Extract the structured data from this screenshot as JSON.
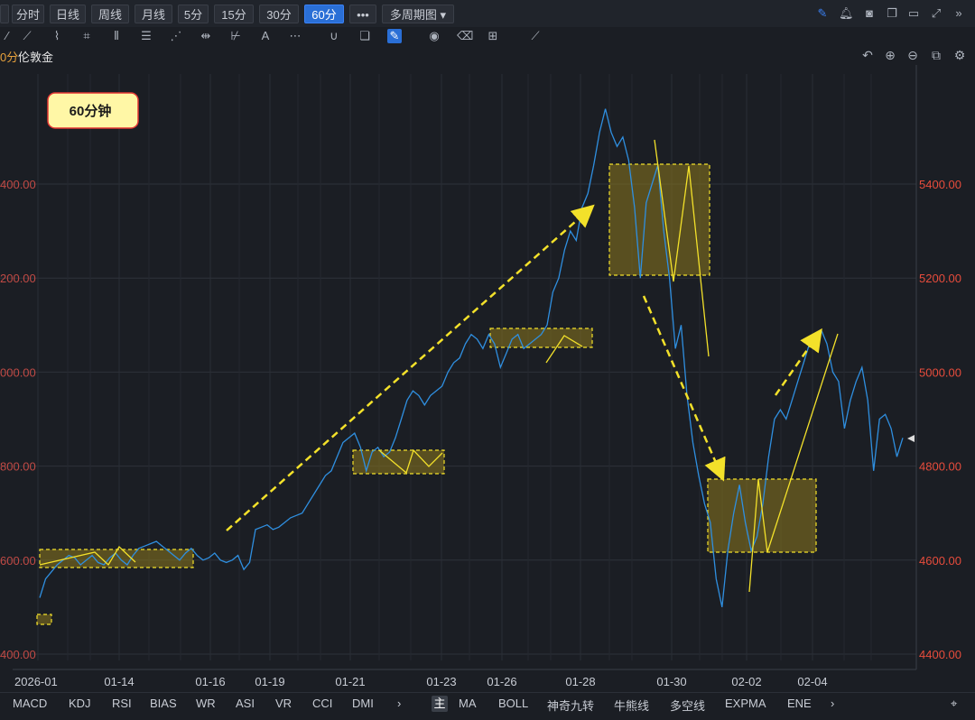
{
  "tabs": [
    "分时",
    "日线",
    "周线",
    "月线",
    "5分",
    "15分",
    "30分",
    "60分",
    "•••",
    "多周期图 ▾"
  ],
  "active_tab": "60分",
  "chart_prefix": "0分",
  "chart_title": "伦敦金",
  "indicators_left": [
    "MACD",
    "KDJ",
    "RSI",
    "BIAS",
    "WR",
    "ASI",
    "VR",
    "CCI",
    "DMI",
    "›"
  ],
  "indicators_main": "主",
  "indicators_right": [
    "MA",
    "BOLL",
    "神奇九转",
    "牛熊线",
    "多空线",
    "EXPMA",
    "ENE",
    "›"
  ],
  "annotation_label": "60分钟",
  "colors": {
    "series": "#2f8fe0",
    "annotation": "#f3e12a",
    "price_right": "#e74c3c",
    "box_fill": "#7a6b1f",
    "label_bg": "#fff7a6",
    "label_border": "#e53935"
  },
  "chart_data": {
    "type": "line",
    "title": "伦敦金",
    "x_ticks": [
      "2026-01",
      "01-14",
      "01-16",
      "01-19",
      "01-21",
      "01-23",
      "01-26",
      "01-28",
      "01-30",
      "02-02",
      "02-04"
    ],
    "y_ticks_left": [
      "400.00",
      "600.00",
      "800.00",
      "000.00",
      "200.00",
      "400.00"
    ],
    "y_ticks_right": [
      "4400.00",
      "4600.00",
      "4800.00",
      "5000.00",
      "5200.00",
      "5400.00"
    ],
    "ylim": [
      4400,
      5500
    ],
    "series": [
      {
        "values": [
          4520,
          4560,
          4575,
          4590,
          4600,
          4610,
          4605,
          4590,
          4600,
          4610,
          4595,
          4590,
          4605,
          4615,
          4600,
          4590,
          4610,
          4625,
          4630,
          4635,
          4640,
          4630,
          4620,
          4610,
          4600,
          4615,
          4625,
          4610,
          4600,
          4605,
          4615,
          4600,
          4595,
          4600,
          4610,
          4580,
          4595,
          4665,
          4670,
          4675,
          4665,
          4670,
          4680,
          4690,
          4695,
          4700,
          4720,
          4740,
          4760,
          4780,
          4790,
          4820,
          4850,
          4860,
          4870,
          4840,
          4790,
          4830,
          4840,
          4820,
          4830,
          4860,
          4900,
          4940,
          4960,
          4950,
          4930,
          4950,
          4960,
          4970,
          5000,
          5020,
          5030,
          5060,
          5080,
          5070,
          5050,
          5080,
          5060,
          5010,
          5040,
          5070,
          5080,
          5050,
          5060,
          5070,
          5080,
          5100,
          5170,
          5200,
          5260,
          5300,
          5280,
          5350,
          5380,
          5440,
          5510,
          5560,
          5510,
          5480,
          5500,
          5450,
          5350,
          5200,
          5360,
          5400,
          5440,
          5300,
          5200,
          5050,
          5100,
          4950,
          4850,
          4780,
          4720,
          4680,
          4560,
          4500,
          4620,
          4700,
          4760,
          4680,
          4620,
          4650,
          4720,
          4820,
          4900,
          4920,
          4900,
          4940,
          4980,
          5020,
          5060,
          5080,
          5090,
          5060,
          5000,
          4980,
          4880,
          4940,
          4980,
          5010,
          4940,
          4790,
          4900,
          4910,
          4880,
          4820,
          4860
        ]
      }
    ]
  }
}
